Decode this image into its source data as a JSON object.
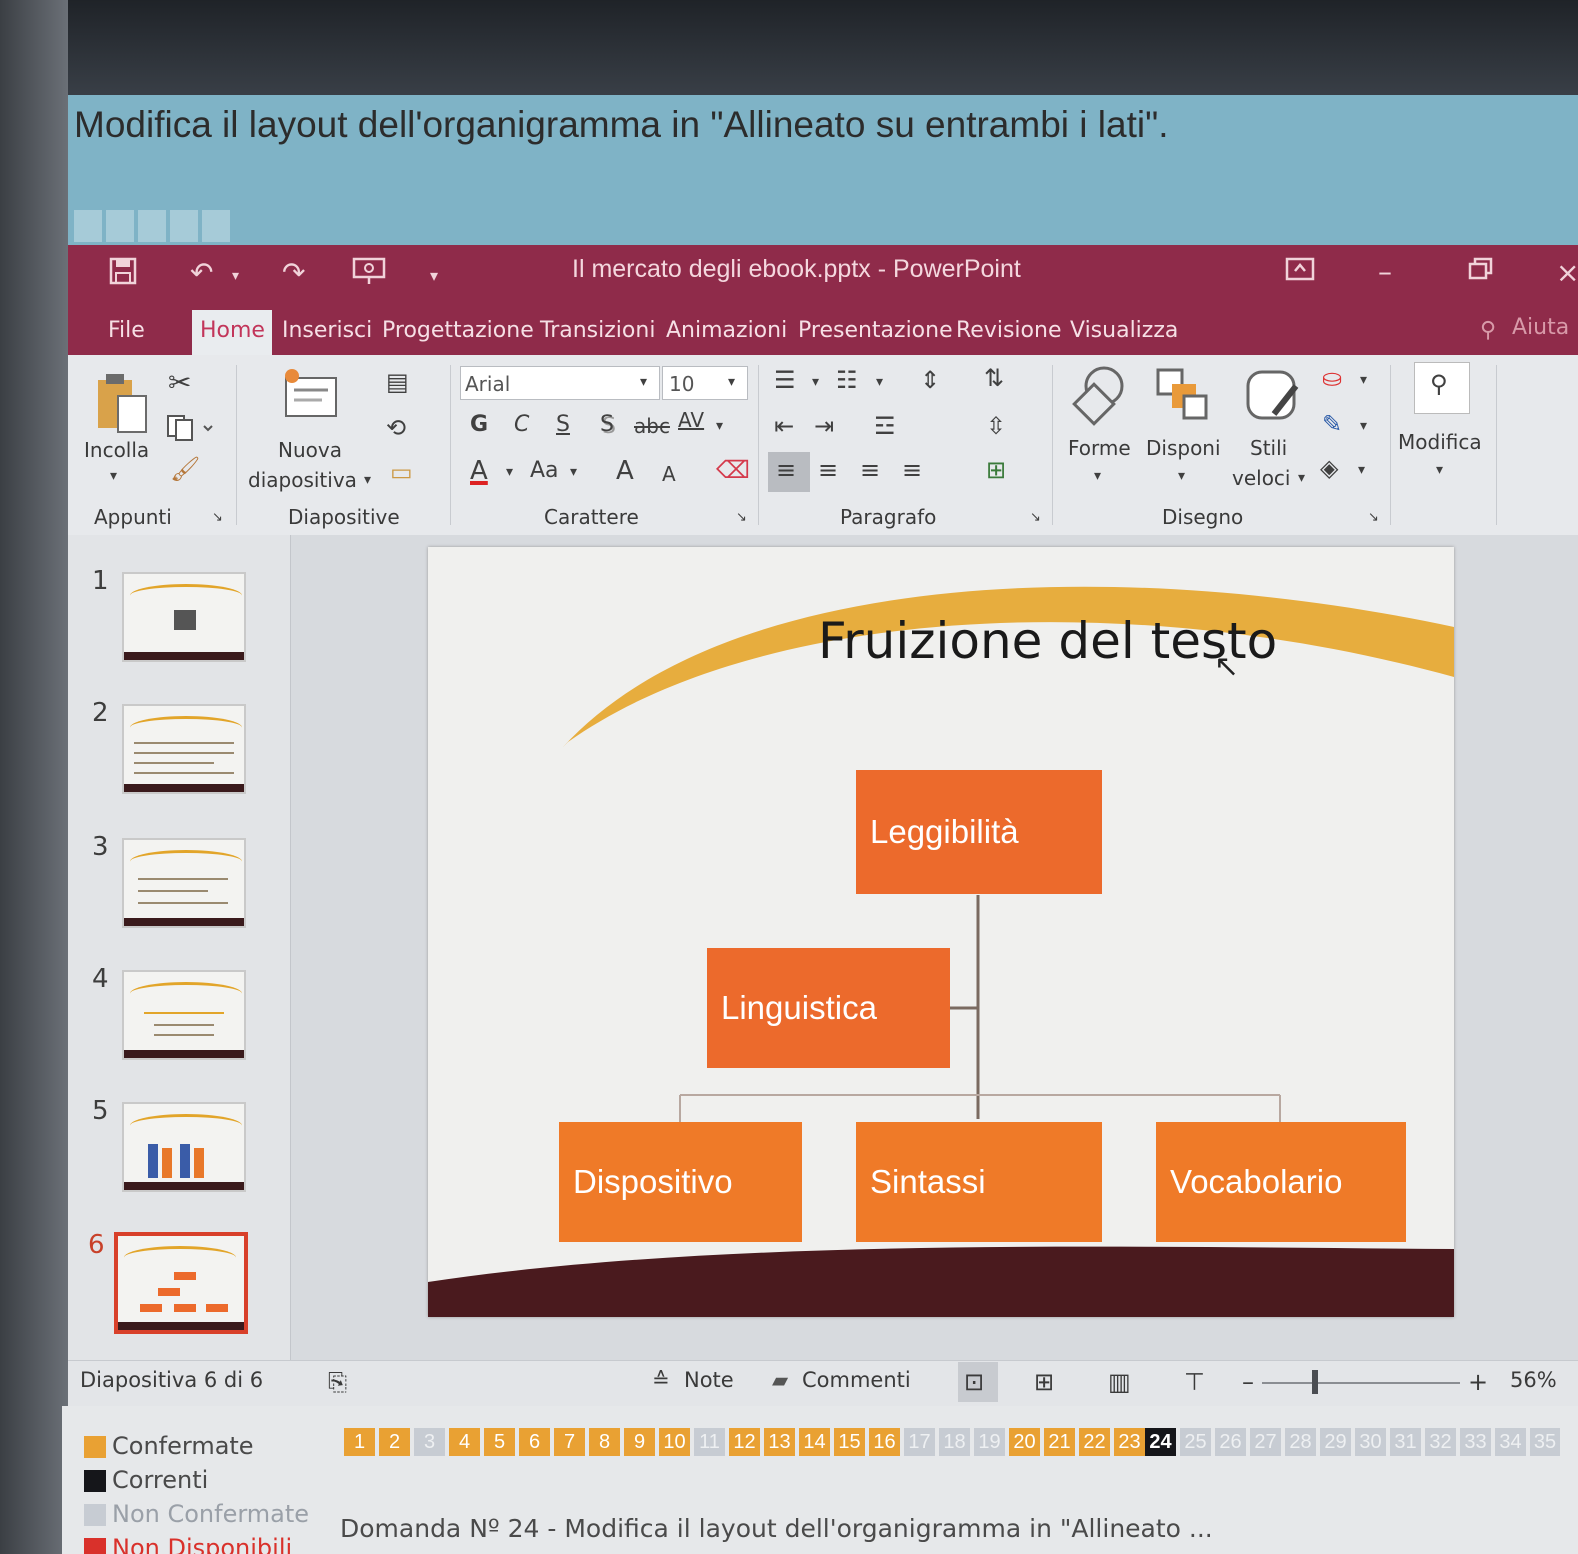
{
  "quiz": {
    "question": "Modifica il layout dell'organigramma in \"Allineato su entrambi i lati\".",
    "footer_question": "Domanda Nº 24 - Modifica il layout dell'organigramma in \"Allineato ...",
    "legend": [
      {
        "label": "Confermate",
        "color": "#e9a133"
      },
      {
        "label": "Correnti",
        "color": "#15161a"
      },
      {
        "label": "Non Confermate",
        "color": "#c7ccd3"
      },
      {
        "label": "Non Disponibili",
        "color": "#d9312b"
      }
    ],
    "numbers": [
      "1",
      "2",
      "3",
      "4",
      "5",
      "6",
      "7",
      "8",
      "9",
      "10",
      "11",
      "12",
      "13",
      "14",
      "15",
      "16",
      "17",
      "18",
      "19",
      "20",
      "21",
      "22",
      "23",
      "24",
      "25",
      "26",
      "27",
      "28",
      "29",
      "30",
      "31",
      "32",
      "33",
      "34",
      "35"
    ]
  },
  "window": {
    "title": "Il mercato degli ebook.pptx - PowerPoint",
    "help": "Aiuta"
  },
  "menu": {
    "tabs": [
      "File",
      "Home",
      "Inserisci",
      "Progettazione",
      "Transizioni",
      "Animazioni",
      "Presentazione",
      "Revisione",
      "Visualizza"
    ]
  },
  "ribbon": {
    "paste": "Incolla",
    "new_slide_1": "Nuova",
    "new_slide_2": "diapositiva",
    "font_name": "Arial",
    "font_size": "10",
    "shapes": "Forme",
    "arrange": "Disponi",
    "quick_styles_1": "Stili",
    "quick_styles_2": "veloci",
    "edit": "Modifica",
    "bold": "G",
    "italic": "C",
    "underline": "S",
    "shadow": "S",
    "strike": "abc",
    "spacing": "AV",
    "font_color": "A",
    "case": "Aa",
    "grow": "A",
    "shrink": "A",
    "groups": {
      "clipboard": "Appunti",
      "slides": "Diapositive",
      "font": "Carattere",
      "paragraph": "Paragrafo",
      "drawing": "Disegno"
    }
  },
  "thumbnails": [
    "1",
    "2",
    "3",
    "4",
    "5",
    "6"
  ],
  "slide": {
    "title": "Fruizione del testo",
    "nodes": {
      "top": "Leggibilità",
      "assistant": "Linguistica",
      "child1": "Dispositivo",
      "child2": "Sintassi",
      "child3": "Vocabolario"
    }
  },
  "status": {
    "slide_counter": "Diapositiva 6 di 6",
    "notes": "Note",
    "comments": "Commenti",
    "zoom": "56%"
  },
  "colors": {
    "title_bar": "#8f2b4a",
    "node_fill": "#ec6a2c",
    "arc": "#e6a52a",
    "slide_base": "#4a1a1e"
  }
}
